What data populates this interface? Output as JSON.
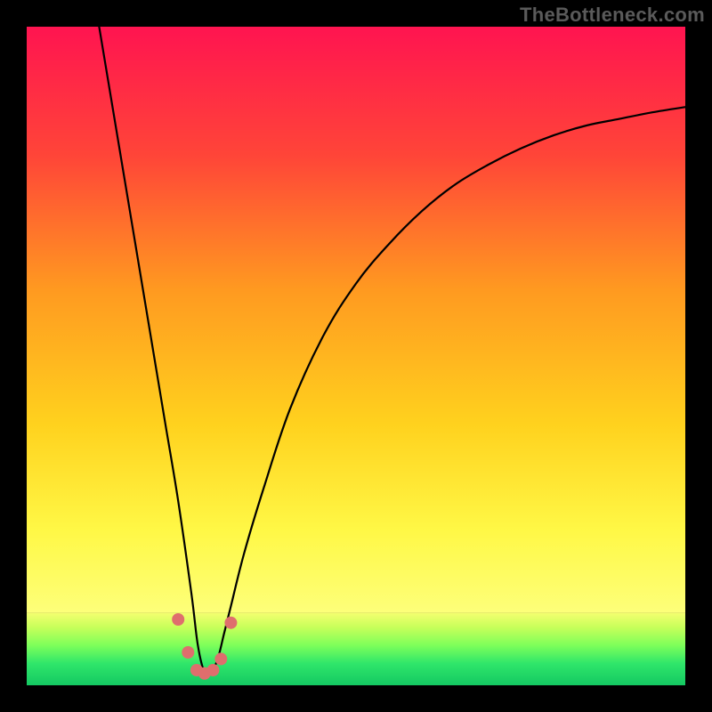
{
  "watermark": "TheBottleneck.com",
  "chart_data": {
    "type": "line",
    "title": "",
    "xlabel": "",
    "ylabel": "",
    "xlim": [
      0,
      100
    ],
    "ylim": [
      0,
      100
    ],
    "grid": false,
    "legend": false,
    "optimal_x": 27,
    "series": [
      {
        "name": "bottleneck_curve",
        "color": "#000000",
        "x": [
          11,
          13,
          15,
          17,
          19,
          21,
          23,
          25,
          26,
          27,
          28,
          29,
          30,
          31,
          33,
          36,
          40,
          45,
          50,
          55,
          60,
          65,
          70,
          75,
          80,
          85,
          90,
          95,
          100
        ],
        "y": [
          100,
          88,
          76,
          64,
          52,
          40,
          28,
          14,
          6,
          2,
          2,
          4,
          8,
          12,
          20,
          30,
          42,
          53,
          61,
          67,
          72,
          76,
          79,
          81.5,
          83.5,
          85,
          86,
          87,
          87.8
        ]
      }
    ],
    "markers": {
      "name": "optimal_zone_points",
      "color": "#df6e6d",
      "radius": 7,
      "x": [
        23.0,
        24.5,
        25.8,
        27.0,
        28.3,
        29.5,
        31.0
      ],
      "y": [
        10.0,
        5.0,
        2.3,
        1.8,
        2.3,
        4.0,
        9.5
      ]
    },
    "background_gradient": {
      "top_color": "#ff1450",
      "mid_colors": [
        "#ff6e2a",
        "#ffd028",
        "#fff850"
      ],
      "green_band_top": "#e9ff6a",
      "green_band_bottom": "#14e56e",
      "green_band_y_range": [
        0,
        11
      ]
    }
  }
}
